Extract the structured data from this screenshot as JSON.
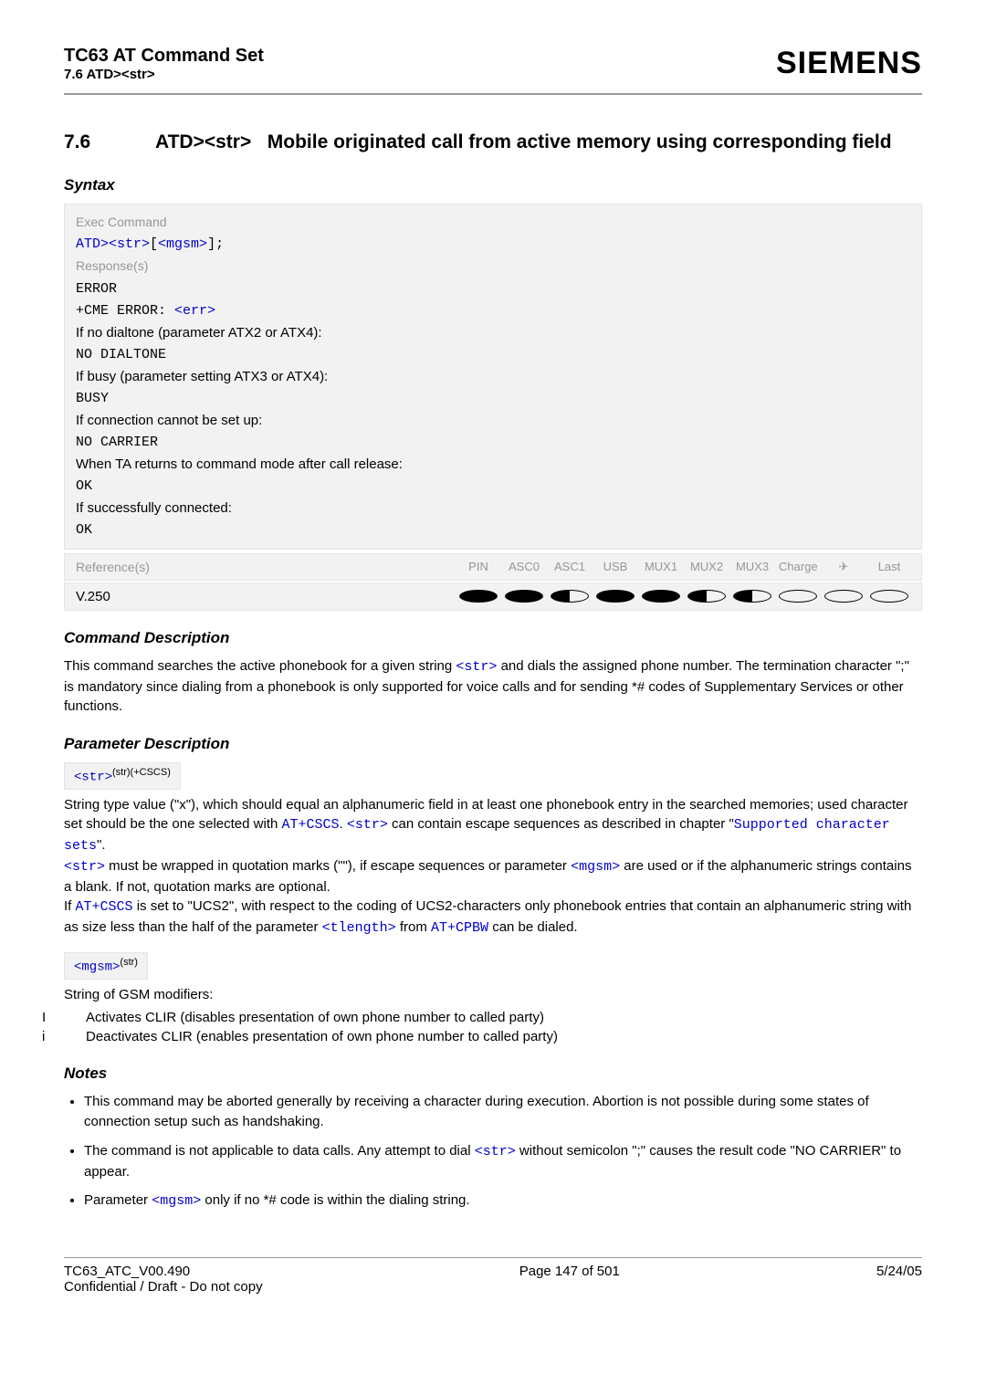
{
  "header": {
    "title": "TC63 AT Command Set",
    "sub": "7.6 ATD><str>",
    "brand": "SIEMENS"
  },
  "section": {
    "num": "7.6",
    "title_cmd": "ATD><str>",
    "title_rest": "Mobile originated call from active memory using corresponding field"
  },
  "syntax": {
    "heading": "Syntax",
    "exec_label": "Exec Command",
    "exec_pre": "ATD>",
    "exec_p1": "<str>",
    "exec_br_open": "[",
    "exec_p2": "<mgsm>",
    "exec_br_close": "];",
    "resp_label": "Response(s)",
    "r1": "ERROR",
    "r2a": "+CME ERROR: ",
    "r2b": "<err>",
    "r3": "If no dialtone (parameter ATX2 or ATX4):",
    "r4": "NO DIALTONE",
    "r5": "If busy (parameter setting ATX3 or ATX4):",
    "r6": "BUSY",
    "r7": "If connection cannot be set up:",
    "r8": "NO CARRIER",
    "r9": "When TA returns to command mode after call release:",
    "r10": "OK",
    "r11": "If successfully connected:",
    "r12": "OK",
    "ref_label": "Reference(s)",
    "ref_cols": [
      "PIN",
      "ASC0",
      "ASC1",
      "USB",
      "MUX1",
      "MUX2",
      "MUX3",
      "Charge",
      "✈",
      "Last"
    ],
    "ref_val": "V.250"
  },
  "cmddesc": {
    "heading": "Command Description",
    "t1": "This command searches the active phonebook for a given string ",
    "t1_link": "<str>",
    "t1b": " and dials the assigned phone number. The termination character \";\" is mandatory since dialing from a phonebook is only supported for voice calls and for sending *# codes of Supplementary Services or other functions."
  },
  "paramdesc": {
    "heading": "Parameter Description",
    "p1_box_a": "<str>",
    "p1_box_b": "(str)(+CSCS)",
    "p1_t1": "String type value (\"x\"), which should equal an alphanumeric field in at least one phonebook entry in the searched memories; used character set should be the one selected with ",
    "p1_l1": "AT+CSCS",
    "p1_t1b": ". ",
    "p1_l1b": "<str>",
    "p1_t1c": " can contain escape sequences as described in chapter \"",
    "p1_l2": "Supported character sets",
    "p1_t1d": "\".",
    "p1_t2a": "<str>",
    "p1_t2b": " must be wrapped in quotation marks (\"\"), if escape sequences or parameter ",
    "p1_t2c": "<mgsm>",
    "p1_t2d": " are used or if the alphanumeric strings contains a blank. If not, quotation marks are optional.",
    "p1_t3a": "If ",
    "p1_t3b": "AT+CSCS",
    "p1_t3c": " is set to \"UCS2\", with respect to the coding of UCS2-characters only phonebook entries that contain an alphanumeric string with as size less than the half of the parameter ",
    "p1_t3d": "<tlength>",
    "p1_t3e": " from ",
    "p1_t3f": "AT+CPBW",
    "p1_t3g": " can be dialed.",
    "p2_box_a": "<mgsm>",
    "p2_box_b": "(str)",
    "p2_t1": "String of GSM modifiers:",
    "p2_i1_pre": "I",
    "p2_i1": "Activates CLIR (disables presentation of own phone number to called party)",
    "p2_i2_pre": "i",
    "p2_i2": "Deactivates CLIR (enables presentation of own phone number to called party)"
  },
  "notes": {
    "heading": "Notes",
    "n1": "This command may be aborted generally by receiving a character during execution. Abortion is not possible during some states of connection setup such as handshaking.",
    "n2a": "The command is not applicable to data calls. Any attempt to dial ",
    "n2b": "<str>",
    "n2c": " without semicolon \";\" causes the result code \"NO CARRIER\" to appear.",
    "n3a": "Parameter ",
    "n3b": "<mgsm>",
    "n3c": " only if no *# code is within the dialing string."
  },
  "footer": {
    "left": "TC63_ATC_V00.490",
    "conf": "Confidential / Draft - Do not copy",
    "center": "Page 147 of 501",
    "right": "5/24/05"
  }
}
